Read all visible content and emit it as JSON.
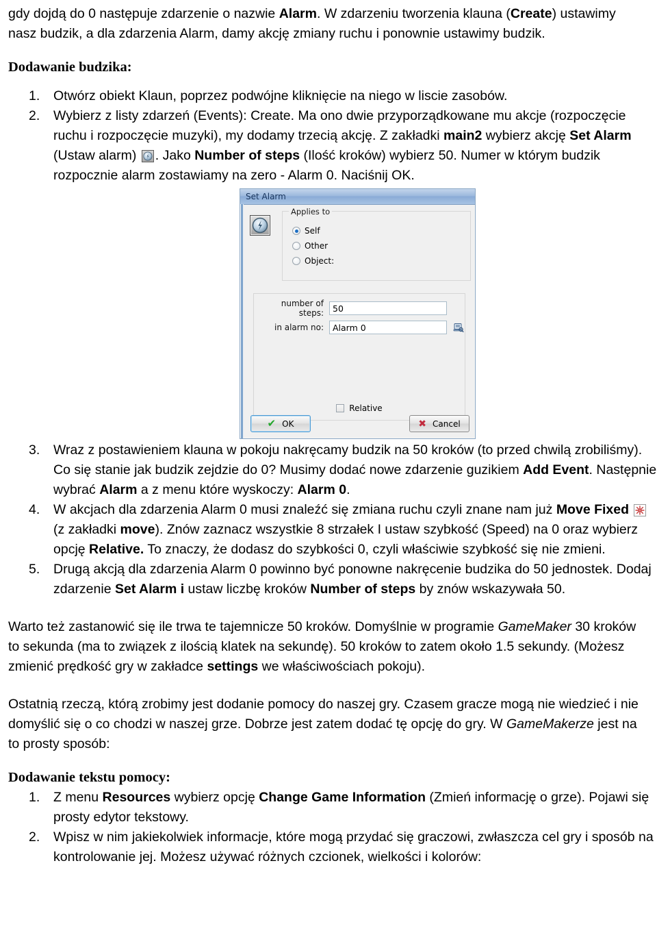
{
  "document": {
    "intro_paragraph": {
      "run1": "gdy dojdą do 0 następuje zdarzenie o nazwie ",
      "bold1": "Alarm",
      "run2": ". W zdarzeniu tworzenia klauna (",
      "bold2": "Create",
      "run3": ") ustawimy nasz budzik, a dla zdarzenia Alarm, damy akcję zmiany ruchu i ponownie ustawimy budzik."
    },
    "heading_add_alarm": "Dodawanie budzika:",
    "steps_1_2": [
      {
        "number": "1.",
        "text": "Otwórz obiekt Klaun, poprzez podwójne kliknięcie na niego w liscie zasobów."
      },
      {
        "number": "2.",
        "run1": "Wybierz z listy zdarzeń (Events): Create. Ma  ono dwie przyporządkowane mu akcje (rozpoczęcie ruchu i rozpoczęcie muzyki), my dodamy trzecią akcję.  Z zakładki ",
        "bold1": "main2",
        "run2": " wybierz akcję ",
        "bold2": "Set Alarm",
        "run3": " (Ustaw alarm) ",
        "icon1": "alarm-clock-icon",
        "run4": ". Jako ",
        "bold3": "Number of steps",
        "run5": " (Ilość kroków) wybierz 50. Numer w którym budzik rozpocznie alarm zostawiamy na zero -  Alarm 0. Naciśnij OK."
      }
    ],
    "steps_3_5": [
      {
        "number": "3.",
        "run1": "Wraz z postawieniem klauna w pokoju nakręcamy budzik na 50 kroków (to przed chwilą zrobiliśmy). Co się stanie jak budzik zejdzie do 0? Musimy dodać nowe zdarzenie guzikiem ",
        "bold1": "Add Event",
        "run2": ". Następnie wybrać  ",
        "bold2": "Alarm",
        "run3": " a z menu które wyskoczy: ",
        "bold3": "Alarm 0",
        "run4": "."
      },
      {
        "number": "4.",
        "run1": "W akcjach dla zdarzenia Alarm 0 musi znaleźć się zmiana ruchu czyli znane nam już ",
        "bold1": "Move Fixed",
        "run2": " ",
        "icon1": "move-fixed-icon",
        "run3": "(z zakładki ",
        "bold2": "move",
        "run4": "). Znów zaznacz wszystkie 8 strzałek I ustaw szybkość (Speed) na 0 oraz wybierz opcję ",
        "bold3": "Relative.",
        "run5": " To znaczy, że dodasz do szybkości 0, czyli właściwie szybkość się nie zmieni."
      },
      {
        "number": "5.",
        "run1": "Drugą akcją dla zdarzenia Alarm 0 powinno być ponowne nakręcenie budzika do 50 jednostek. Dodaj zdarzenie ",
        "bold1": "Set Alarm i",
        "run2": " ustaw liczbę kroków ",
        "bold2": "Number of steps",
        "run3": " by znów wskazywała 50."
      }
    ],
    "paragraph_steps_info": {
      "run1": "Warto też zastanowić się ile trwa te tajemnicze 50 kroków. Domyślnie w programie ",
      "italic1": "GameMaker",
      "run2": " 30 kroków to sekunda (ma to związek z ilością klatek na sekundę). 50 kroków to zatem około 1.5 sekundy. (Możesz zmienić prędkość gry w zakładce ",
      "bold1": "settings",
      "run3": " we właściwościach pokoju)."
    },
    "paragraph_help_info": {
      "run1": "Ostatnią rzeczą, którą zrobimy jest dodanie pomocy do naszej gry. Czasem gracze mogą nie wiedzieć i nie domyślić się o co chodzi w naszej grze. Dobrze jest zatem dodać tę opcję do gry. W ",
      "italic1": "GameMakerze",
      "run2": " jest na to prosty sposób:"
    },
    "heading_add_help": "Dodawanie tekstu pomocy:",
    "help_steps": [
      {
        "number": "1.",
        "run1": "Z menu ",
        "bold1": "Resources",
        "run2": " wybierz opcję ",
        "bold2": "Change Game Information",
        "run3": " (Zmień informację o grze). Pojawi się prosty edytor tekstowy."
      },
      {
        "number": "2.",
        "run1": "Wpisz w nim jakiekolwiek informacje, które mogą przydać się graczowi, zwłaszcza cel gry i sposób na kontrolowanie jej. Możesz używać różnych czcionek, wielkości i kolorów:"
      }
    ]
  },
  "set_alarm_dialog": {
    "title": "Set Alarm",
    "icon": "alarm-clock-icon",
    "applies_to": {
      "legend": "Applies to",
      "options": [
        {
          "label": "Self",
          "selected": true
        },
        {
          "label": "Other",
          "selected": false
        },
        {
          "label": "Object:",
          "selected": false
        }
      ]
    },
    "fields": [
      {
        "label": "number of steps:",
        "value": "50",
        "has_menu_icon": false
      },
      {
        "label": "in alarm no:",
        "value": "Alarm 0",
        "has_menu_icon": true
      }
    ],
    "relative": {
      "label": "Relative",
      "checked": false
    },
    "buttons": {
      "ok": "OK",
      "cancel": "Cancel"
    },
    "colors": {
      "titlebar": "#9db9dd",
      "body": "#f0f0f0",
      "radio_accent": "#1e6fc4",
      "ok_check": "#22a52b",
      "cancel_x": "#c22b3d"
    }
  }
}
